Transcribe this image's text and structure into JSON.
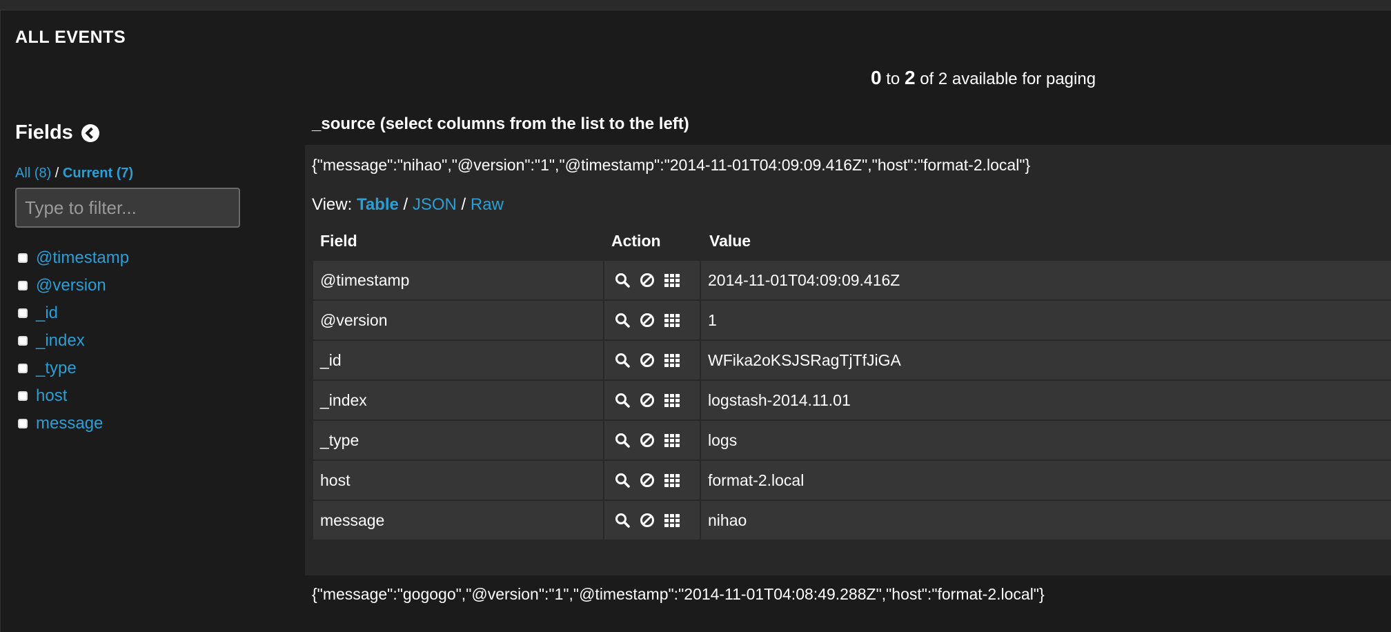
{
  "panel": {
    "title": "ALL EVENTS"
  },
  "paging": {
    "from": "0",
    "to_word": "to",
    "to": "2",
    "rest": "of 2 available for paging"
  },
  "sidebar": {
    "heading": "Fields",
    "tab_all": "All (8)",
    "separator": "/",
    "tab_current": "Current (7)",
    "filter_placeholder": "Type to filter...",
    "fields": [
      "@timestamp",
      "@version",
      "_id",
      "_index",
      "_type",
      "host",
      "message"
    ]
  },
  "main": {
    "source_header": "_source (select columns from the list to the left)",
    "event1_json": "{\"message\":\"nihao\",\"@version\":\"1\",\"@timestamp\":\"2014-11-01T04:09:09.416Z\",\"host\":\"format-2.local\"}",
    "view_label": "View:",
    "view_table": "Table",
    "view_json": "JSON",
    "view_raw": "Raw",
    "view_sep": "/",
    "columns": {
      "field": "Field",
      "action": "Action",
      "value": "Value"
    },
    "rows": [
      {
        "field": "@timestamp",
        "value": "2014-11-01T04:09:09.416Z"
      },
      {
        "field": "@version",
        "value": "1"
      },
      {
        "field": "_id",
        "value": "WFika2oKSJSRagTjTfJiGA"
      },
      {
        "field": "_index",
        "value": "logstash-2014.11.01"
      },
      {
        "field": "_type",
        "value": "logs"
      },
      {
        "field": "host",
        "value": "format-2.local"
      },
      {
        "field": "message",
        "value": "nihao"
      }
    ],
    "event2_json": "{\"message\":\"gogogo\",\"@version\":\"1\",\"@timestamp\":\"2014-11-01T04:08:49.288Z\",\"host\":\"format-2.local\"}"
  },
  "icons": {
    "search": "search-icon",
    "exclude": "ban-icon",
    "column": "th-grid-icon"
  },
  "colors": {
    "background": "#1b1b1b",
    "link": "#2a9fd6",
    "row": "#363636",
    "event_box": "#282828"
  }
}
